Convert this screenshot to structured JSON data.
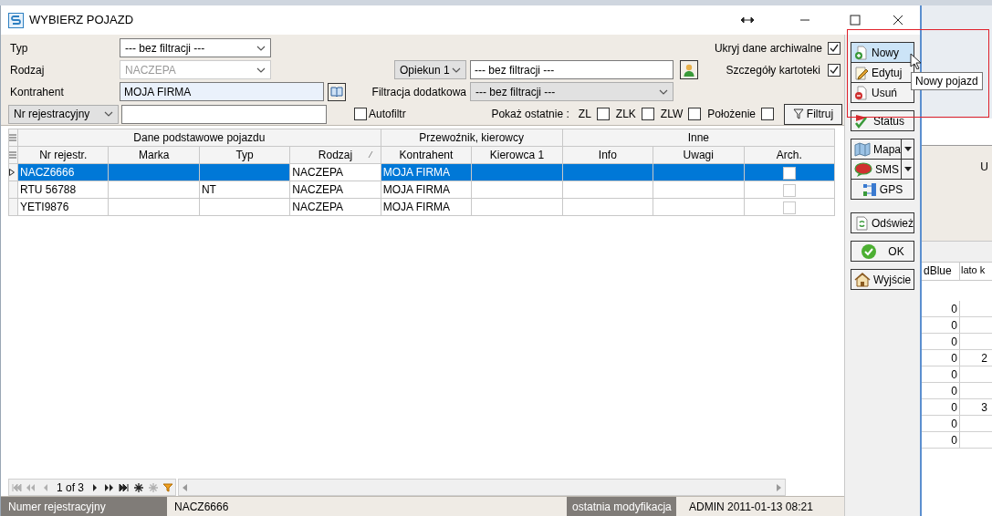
{
  "window": {
    "title": "WYBIERZ POJAZD"
  },
  "filters": {
    "type": {
      "label": "Typ",
      "value": "--- bez filtracji ---",
      "disabled": false
    },
    "kind": {
      "label": "Rodzaj",
      "value": "NACZEPA",
      "disabled": true
    },
    "contractor": {
      "label": "Kontrahent",
      "value": "MOJA FIRMA"
    },
    "search_by": {
      "value": "Nr rejestracyjny"
    },
    "guardian": {
      "select": "Opiekun 1",
      "value": "--- bez filtracji ---"
    },
    "extra": {
      "label": "Filtracja dodatkowa",
      "value": "--- bez filtracji ---"
    },
    "autofilter": {
      "label": "Autofiltr",
      "checked": false
    },
    "hide_archived": {
      "label": "Ukryj dane archiwalne",
      "checked": true
    },
    "details": {
      "label": "Szczegóły kartoteki",
      "checked": true
    },
    "show_last": {
      "label": "Pokaż ostatnie :",
      "options": [
        {
          "label": "ZL",
          "checked": false
        },
        {
          "label": "ZLK",
          "checked": false
        },
        {
          "label": "ZLW",
          "checked": false
        },
        {
          "label": "Położenie",
          "checked": false
        }
      ]
    },
    "filter_button": "Filtruj"
  },
  "grid": {
    "groups": [
      {
        "label": "Dane podstawowe pojazdu"
      },
      {
        "label": "Przewoźnik, kierowcy"
      },
      {
        "label": "Inne"
      }
    ],
    "columns": [
      {
        "label": "Nr rejestr.",
        "sorted": false
      },
      {
        "label": "Marka",
        "sorted": false
      },
      {
        "label": "Typ",
        "sorted": false
      },
      {
        "label": "Rodzaj",
        "sorted": true
      },
      {
        "label": "Kontrahent",
        "sorted": false
      },
      {
        "label": "Kierowca 1",
        "sorted": false
      },
      {
        "label": "Info",
        "sorted": false
      },
      {
        "label": "Uwagi",
        "sorted": false
      },
      {
        "label": "Arch.",
        "sorted": false
      }
    ],
    "rows": [
      {
        "selected": true,
        "archived": false,
        "cells": [
          "NACZ6666",
          "",
          "",
          "NACZEPA",
          "MOJA FIRMA",
          "",
          "",
          ""
        ]
      },
      {
        "selected": false,
        "archived": false,
        "cells": [
          "RTU 56788",
          "",
          "NT",
          "NACZEPA",
          "MOJA FIRMA",
          "",
          "",
          ""
        ]
      },
      {
        "selected": false,
        "archived": false,
        "cells": [
          "YETI9876",
          "",
          "",
          "NACZEPA",
          "MOJA FIRMA",
          "",
          "",
          ""
        ]
      }
    ]
  },
  "pager": {
    "page": "1 of 3"
  },
  "status_bar": {
    "field_label": "Numer rejestracyjny",
    "field_value": "NACZ6666",
    "modified_label": "ostatnia modyfikacja",
    "modified_value": "ADMIN 2011-01-13 08:21"
  },
  "sidebar": {
    "groups": [
      [
        {
          "label": "Nowy",
          "kind": "button",
          "highlighted": true
        },
        {
          "label": "Edytuj",
          "kind": "button",
          "highlighted": false
        },
        {
          "label": "Usuń",
          "kind": "button",
          "highlighted": false
        }
      ],
      [
        {
          "label": "Status",
          "kind": "button",
          "highlighted": false
        }
      ],
      [
        {
          "label": "Mapa",
          "kind": "split",
          "highlighted": false
        },
        {
          "label": "SMS",
          "kind": "split",
          "highlighted": false
        },
        {
          "label": "GPS",
          "kind": "button",
          "highlighted": false
        }
      ],
      [
        {
          "label": "Odśwież",
          "kind": "button",
          "highlighted": false
        }
      ],
      [
        {
          "label": "OK",
          "kind": "button",
          "highlighted": false
        }
      ],
      [
        {
          "label": "Wyjście",
          "kind": "button",
          "highlighted": false
        }
      ]
    ]
  },
  "tooltip": "Nowy pojazd",
  "background_window": {
    "panel_text": "U",
    "columns": [
      "dBlue",
      "lato k"
    ],
    "rows": [
      [
        "0",
        ""
      ],
      [
        "0",
        ""
      ],
      [
        "0",
        ""
      ],
      [
        "0",
        "2"
      ],
      [
        "0",
        ""
      ],
      [
        "0",
        ""
      ],
      [
        "0",
        "3"
      ],
      [
        "0",
        ""
      ],
      [
        "0",
        ""
      ]
    ]
  }
}
